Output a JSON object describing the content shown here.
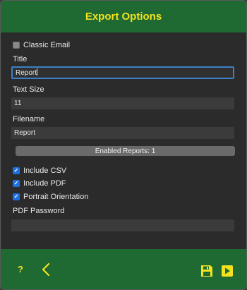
{
  "header": {
    "title": "Export Options"
  },
  "options": {
    "classic_email": {
      "label": "Classic Email",
      "checked": false
    },
    "title": {
      "label": "Title",
      "value": "Report"
    },
    "text_size": {
      "label": "Text Size",
      "value": "11"
    },
    "filename": {
      "label": "Filename",
      "value": "Report"
    },
    "enabled_reports_button": "Enabled Reports: 1",
    "include_csv": {
      "label": "Include CSV",
      "checked": true
    },
    "include_pdf": {
      "label": "Include PDF",
      "checked": true
    },
    "portrait_orientation": {
      "label": "Portrait Orientation",
      "checked": true
    },
    "pdf_password": {
      "label": "PDF Password",
      "value": ""
    }
  },
  "footer": {
    "help_label": "?",
    "icons": [
      "help-icon",
      "back-arrow-icon",
      "save-disk-icon",
      "play-export-icon"
    ]
  },
  "colors": {
    "bar": "#1e6a32",
    "accent": "#f2e21f",
    "check": "#1f6fe0",
    "focus": "#3c80c8"
  }
}
